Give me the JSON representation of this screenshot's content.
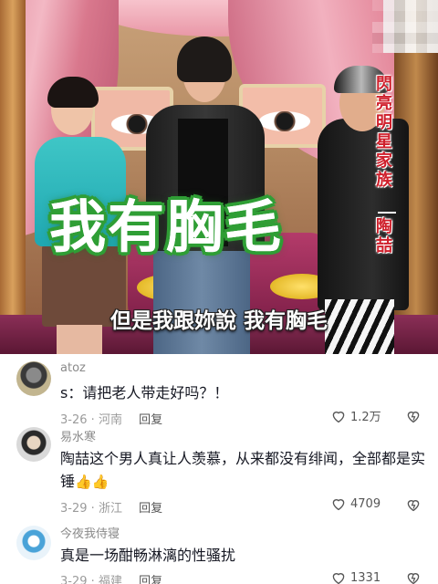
{
  "video": {
    "big_caption": "我有胸毛",
    "subtitle": "但是我跟妳說 我有胸毛",
    "side_title": "閃亮明星家族",
    "side_name": "陶喆"
  },
  "comments": [
    {
      "username": "atoz",
      "text": "s：请把老人带走好吗？！",
      "date": "3-26",
      "location": "河南",
      "reply_label": "回复",
      "likes": "1.2万"
    },
    {
      "username": "易水寒",
      "text": "陶喆这个男人真让人羡慕，从来都没有绯闻，全部都是实锤",
      "emoji": "👍👍",
      "date": "3-29",
      "location": "浙江",
      "reply_label": "回复",
      "likes": "4709"
    },
    {
      "username": "今夜我侍寝",
      "text": "真是一场酣畅淋漓的性骚扰",
      "date": "3-29",
      "location": "福建",
      "reply_label": "回复",
      "likes": "1331"
    }
  ],
  "colors": {
    "caption_outline": "#2f9e35",
    "side_text": "#cf1f2b",
    "comment_text": "#161823",
    "meta_text": "#9b9b9b"
  },
  "icons": [
    "heart-outline-icon",
    "dislike-heart-icon",
    "thumbs-up-emoji"
  ]
}
